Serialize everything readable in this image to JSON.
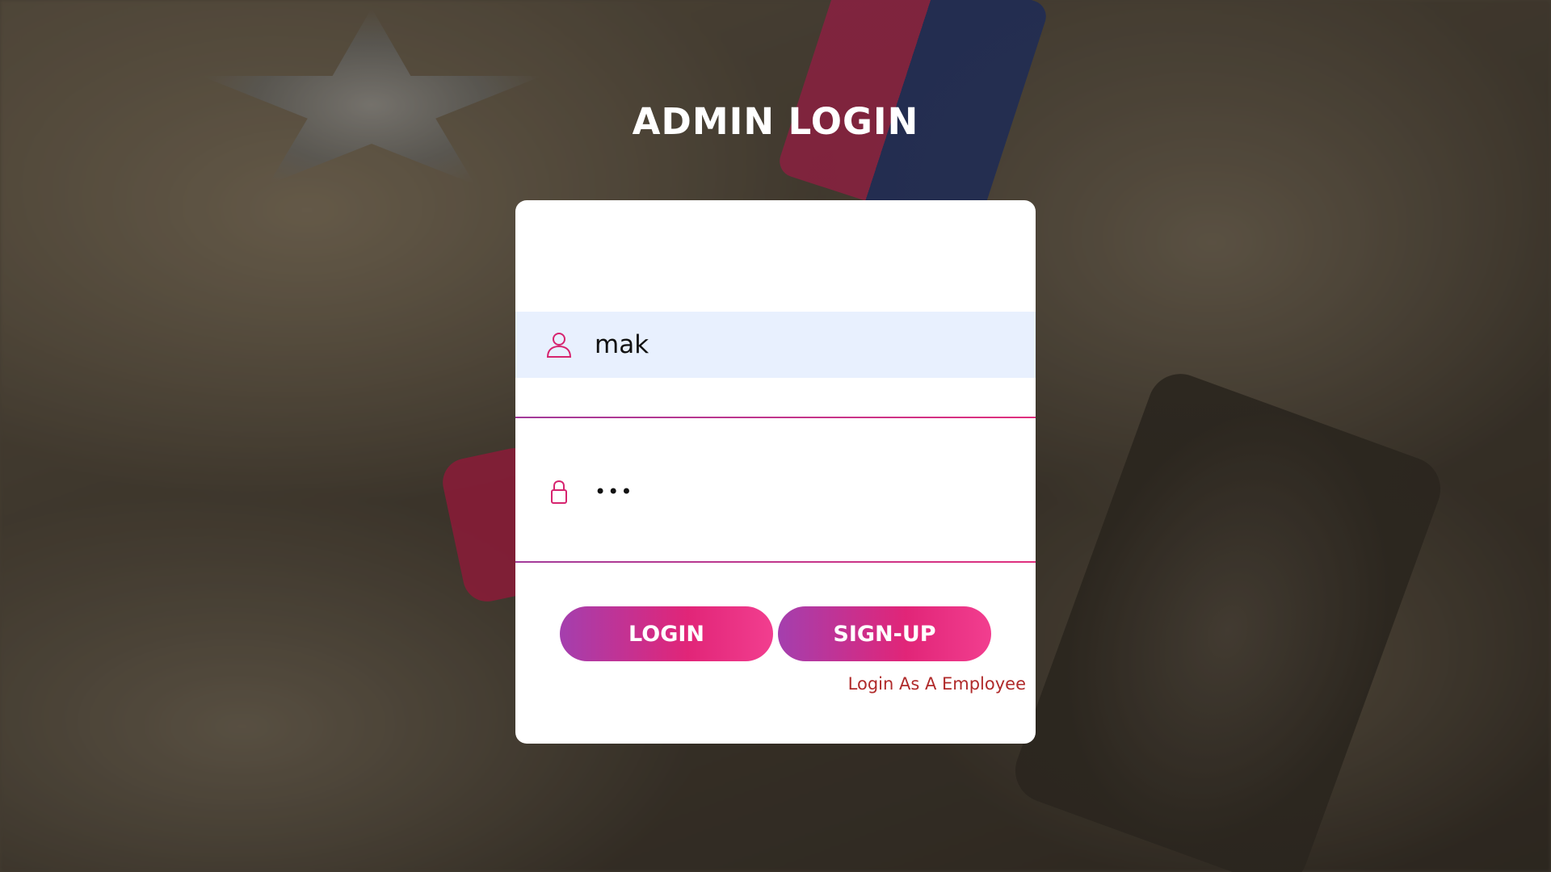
{
  "page": {
    "title": "ADMIN LOGIN"
  },
  "form": {
    "username": {
      "value": "mak",
      "icon": "user-icon"
    },
    "password": {
      "value": "abc",
      "icon": "lock-icon"
    },
    "login_label": "LOGIN",
    "signup_label": "SIGN-UP",
    "employee_link": "Login As A Employee"
  },
  "colors": {
    "accent_start": "#a43fae",
    "accent_end": "#f23e8f",
    "link": "#b02a2a",
    "autofill_bg": "#e8f0fe"
  }
}
